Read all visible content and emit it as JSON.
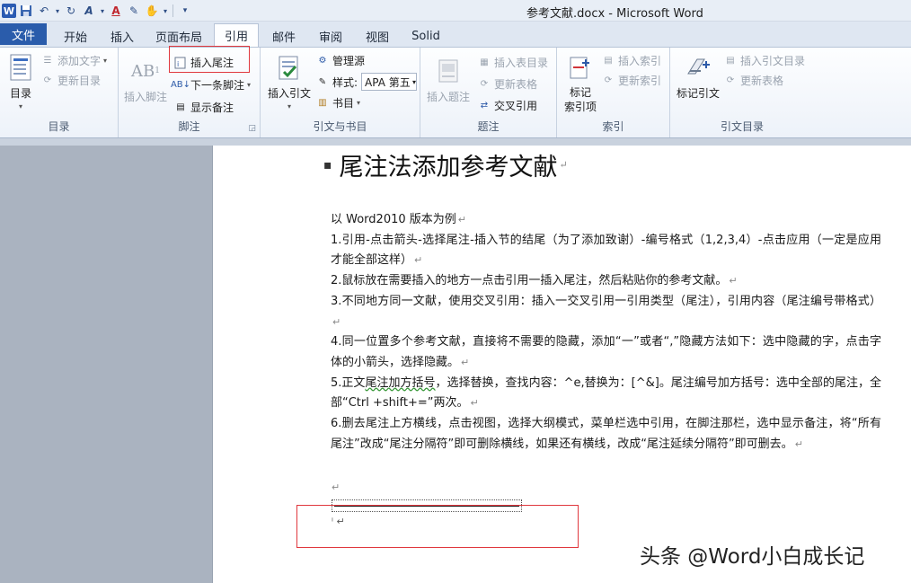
{
  "window": {
    "title": "参考文献.docx  -  Microsoft Word"
  },
  "qat": {
    "app_icon": "W"
  },
  "tabs": {
    "file": "文件",
    "items": [
      "开始",
      "插入",
      "页面布局",
      "引用",
      "邮件",
      "审阅",
      "视图",
      "Solid"
    ],
    "active": "引用"
  },
  "ribbon": {
    "toc": {
      "label": "目录",
      "toc_button": "目录",
      "add_text": "添加文字",
      "update_toc": "更新目录"
    },
    "footnotes": {
      "label": "脚注",
      "insert_footnote": "插入脚注",
      "insert_endnote": "插入尾注",
      "next_footnote": "下一条脚注",
      "show_notes": "显示备注"
    },
    "citations": {
      "label": "引文与书目",
      "insert_citation": "插入引文",
      "manage_sources": "管理源",
      "style_label": "样式:",
      "style_value": "APA 第五",
      "bibliography": "书目"
    },
    "captions": {
      "label": "题注",
      "insert_caption": "插入题注",
      "insert_table_of_figures": "插入表目录",
      "update_table": "更新表格",
      "cross_reference": "交叉引用"
    },
    "index": {
      "label": "索引",
      "mark_entry": "标记\n索引项",
      "insert_index": "插入索引",
      "update_index": "更新索引"
    },
    "toa": {
      "label": "引文目录",
      "mark_citation": "标记引文",
      "insert_toa": "插入引文目录",
      "update_table": "更新表格"
    }
  },
  "document": {
    "heading": "尾注法添加参考文献",
    "para_mark": "↵",
    "paragraphs": [
      "以 Word2010 版本为例",
      "1.引用-点击箭头-选择尾注-插入节的结尾（为了添加致谢）-编号格式（1,2,3,4）-点击应用（一定是应用才能全部这样）",
      "2.鼠标放在需要插入的地方一点击引用一插入尾注，然后粘贴你的参考文献。",
      "3.不同地方同一文献，使用交叉引用：插入一交叉引用一引用类型（尾注），引用内容（尾注编号带格式）",
      "4.同一位置多个参考文献，直接将不需要的隐藏，添加“一”或者“,”隐藏方法如下：选中隐藏的字，点击字体的小箭头，选择隐藏。",
      "5.正文尾注加方括号，选择替换，查找内容：^e,替换为：[^&]。尾注编号加方括号：选中全部的尾注，全部“Ctrl +shift+=”两次。",
      "6.删去尾注上方横线，点击视图，选择大纲模式，菜单栏选中引用，在脚注那栏，选中显示备注，将“所有尾注”改成“尾注分隔符”即可删除横线，如果还有横线，改成“尾注延续分隔符”即可删去。"
    ],
    "p5_prefix": "5.正文",
    "p5_squiggle": "尾注加方括号",
    "p5_rest": "，选择替换，查找内容：^e,替换为：[^&]。尾注编号加方括号：选中全部的尾注，全部“Ctrl +shift+=”两次。"
  },
  "watermark": "头条 @Word小白成长记",
  "colors": {
    "file_tab": "#2a5cab",
    "highlight_box": "#e0383e",
    "page": "#ffffff",
    "workspace": "#aab3c0"
  }
}
